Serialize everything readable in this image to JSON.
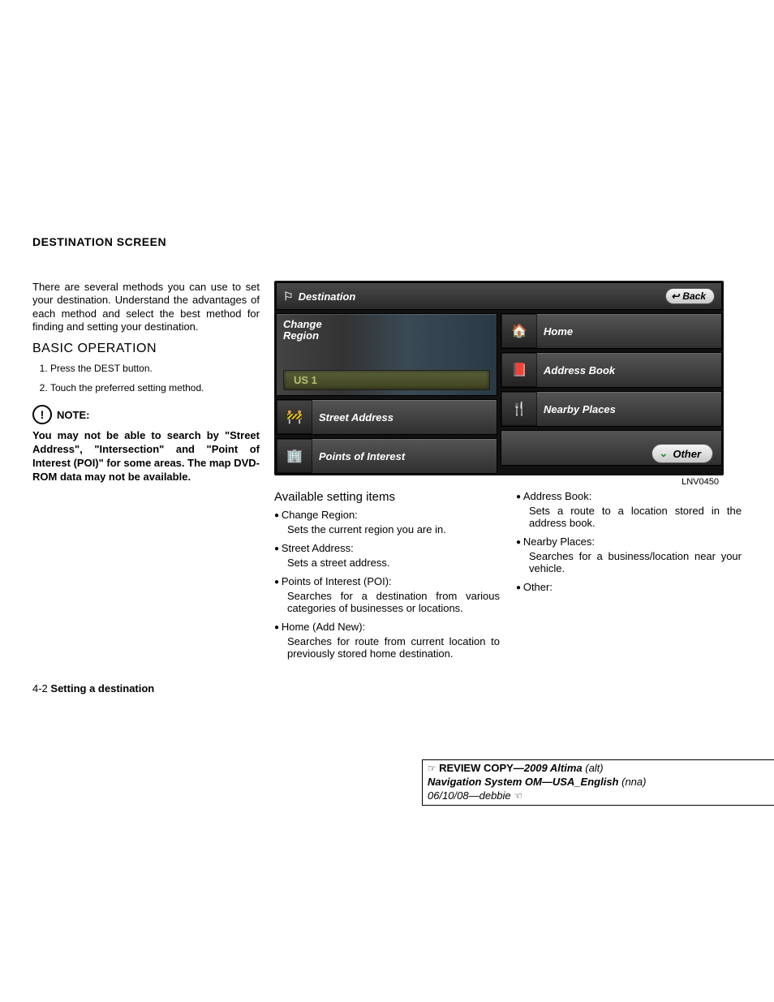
{
  "heading": "DESTINATION SCREEN",
  "intro": "There are several methods you can use to set your destination. Understand the advantages of each method and select the best method for finding and setting your destination.",
  "basic_op_head": "BASIC OPERATION",
  "steps": [
    "Press the DEST button.",
    "Touch the preferred setting method."
  ],
  "note_label": "NOTE:",
  "note_body": "You may not be able to search by \"Street Address\", \"Intersection\" and \"Point of Interest (POI)\" for some areas. The map DVD-ROM data may not be available.",
  "screen": {
    "title": "Destination",
    "back": "Back",
    "change_region_label": "Change\nRegion",
    "change_region_value": "US 1",
    "street_address": "Street Address",
    "poi": "Points of Interest",
    "home": "Home",
    "address_book": "Address Book",
    "nearby": "Nearby Places",
    "other": "Other",
    "fig_id": "LNV0450"
  },
  "avail_head": "Available setting items",
  "items_left": [
    {
      "t": "Change Region:",
      "d": "Sets the current region you are in."
    },
    {
      "t": "Street Address:",
      "d": "Sets a street address."
    },
    {
      "t": "Points of Interest (POI):",
      "d": "Searches for a destination from various categories of businesses or locations."
    },
    {
      "t": "Home (Add New):",
      "d": "Searches for route from current location to previously stored home destination."
    }
  ],
  "items_right": [
    {
      "t": "Address Book:",
      "d": "Sets a route to a location stored in the address book."
    },
    {
      "t": "Nearby Places:",
      "d": "Searches for a business/location near your vehicle."
    },
    {
      "t": "Other:",
      "d": ""
    }
  ],
  "pagenum_prefix": "4-2 ",
  "pagenum_section": "Setting a destination",
  "review": {
    "line1a": "REVIEW COPY—",
    "line1b": "2009 Altima",
    "line1c": " (alt)",
    "line2a": "Navigation System OM—USA_English",
    "line2b": " (nna)",
    "line3": "06/10/08—debbie"
  }
}
